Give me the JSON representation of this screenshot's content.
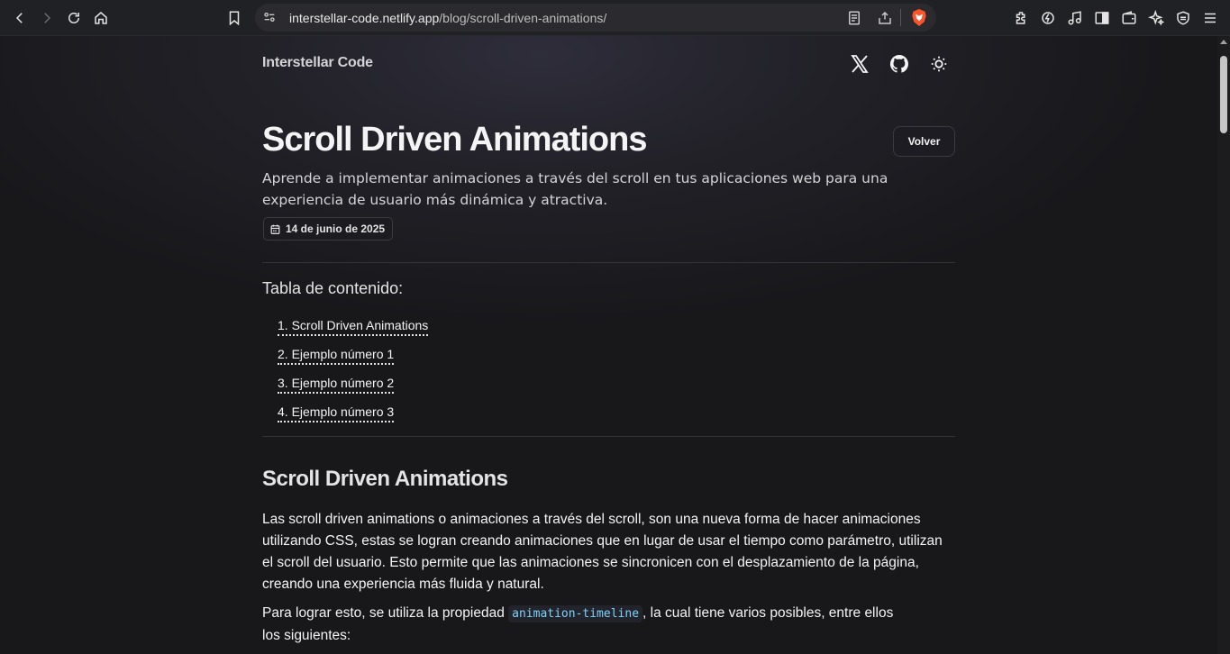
{
  "browser": {
    "url_host": "interstellar-code.netlify.app",
    "url_path": "/blog/scroll-driven-animations/"
  },
  "header": {
    "brand": "Interstellar Code"
  },
  "article": {
    "title": "Scroll Driven Animations",
    "back_label": "Volver",
    "description": "Aprende a implementar animaciones a través del scroll en tus aplicaciones web para una experiencia de usuario más dinámica y atractiva.",
    "date": "14 de junio de 2025"
  },
  "toc": {
    "title": "Tabla de contenido:",
    "items": [
      "1. Scroll Driven Animations",
      "2. Ejemplo número 1",
      "3. Ejemplo número 2",
      "4. Ejemplo número 3"
    ]
  },
  "section": {
    "heading": "Scroll Driven Animations",
    "paragraph1": "Las scroll driven animations o animaciones a través del scroll, son una nueva forma de hacer animaciones utilizando CSS, estas se logran creando animaciones que en lugar de usar el tiempo como parámetro, utilizan el scroll del usuario. Esto permite que las animaciones se sincronicen con el desplazamiento de la página, creando una experiencia más fluida y natural.",
    "paragraph2_before": "Para lograr esto, se utiliza la propiedad ",
    "paragraph2_code": "animation-timeline",
    "paragraph2_after_line1": ", la cual tiene varios posibles, entre ellos",
    "paragraph2_line2": "los siguientes:"
  }
}
